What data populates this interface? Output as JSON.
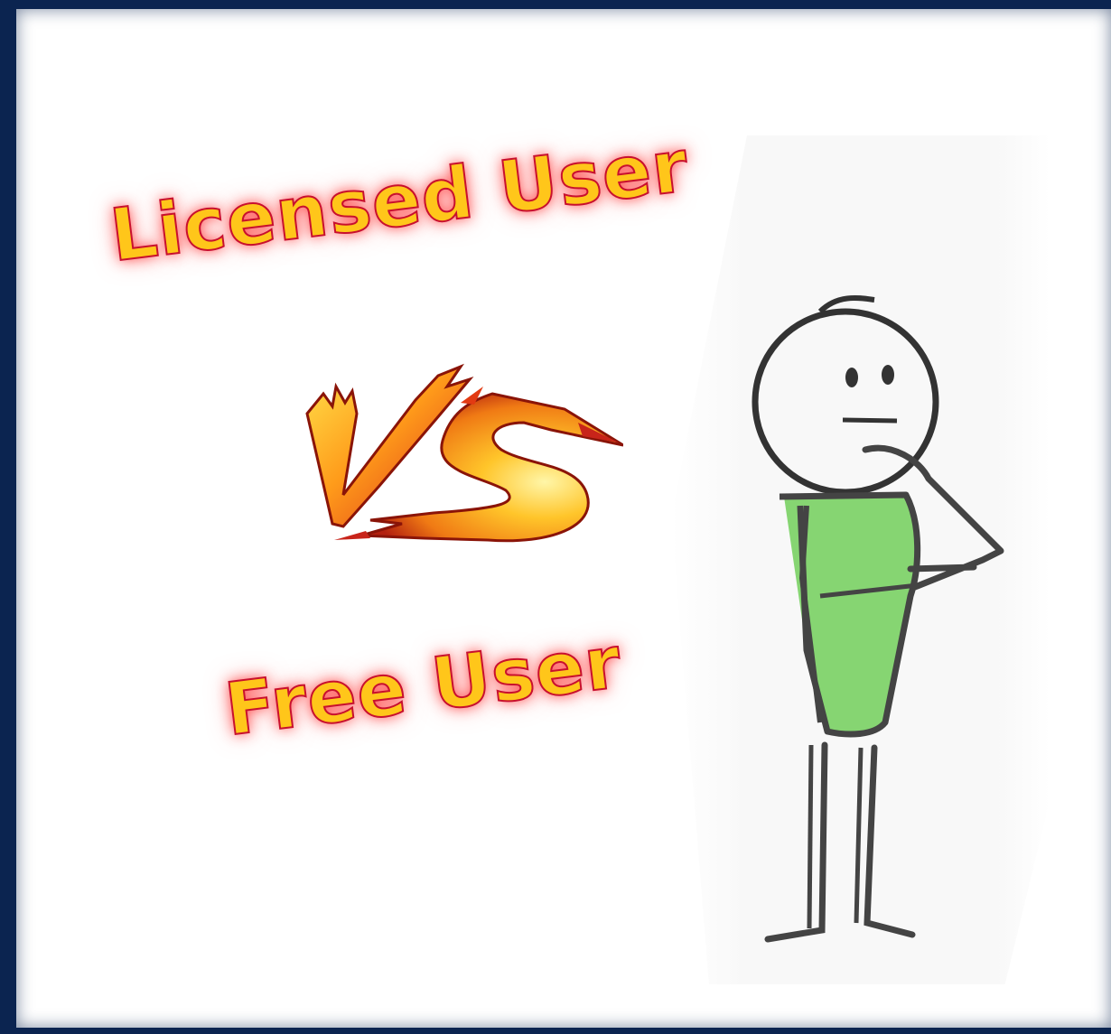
{
  "labels": {
    "licensed": "Licensed User",
    "free": "Free User"
  },
  "icons": {
    "vs": "vs-fire-icon",
    "figure": "thinking-stick-figure"
  },
  "colors": {
    "frame": "#0b2450",
    "text_fill": "#ffc61a",
    "text_stroke": "#c8102e",
    "glow": "#ff5050",
    "body": "#7fd36a"
  }
}
